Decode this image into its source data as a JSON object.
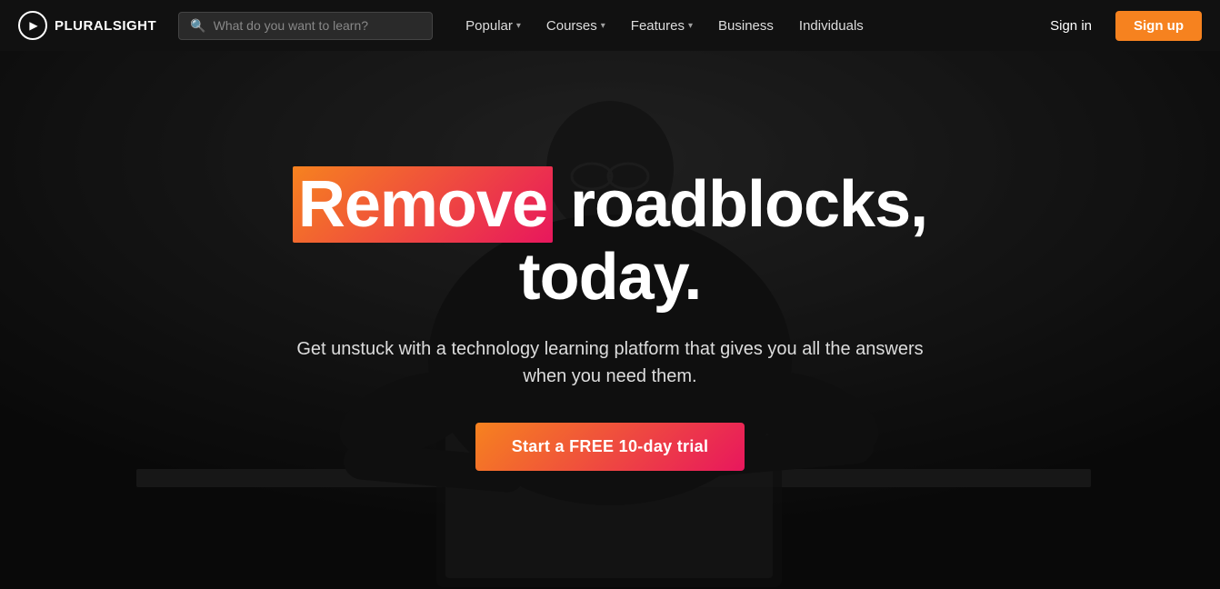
{
  "navbar": {
    "logo_text": "PLURALSIGHT",
    "search_placeholder": "What do you want to learn?",
    "nav_items": [
      {
        "label": "Popular",
        "has_dropdown": true
      },
      {
        "label": "Courses",
        "has_dropdown": true
      },
      {
        "label": "Features",
        "has_dropdown": true
      },
      {
        "label": "Business",
        "has_dropdown": false
      },
      {
        "label": "Individuals",
        "has_dropdown": false
      }
    ],
    "sign_in_label": "Sign in",
    "sign_up_label": "Sign up"
  },
  "hero": {
    "title_highlight": "Remove",
    "title_rest": " roadblocks, today.",
    "subtitle": "Get unstuck with a technology learning platform that gives you all the answers when you need them.",
    "cta_label": "Start a FREE 10-day trial"
  }
}
